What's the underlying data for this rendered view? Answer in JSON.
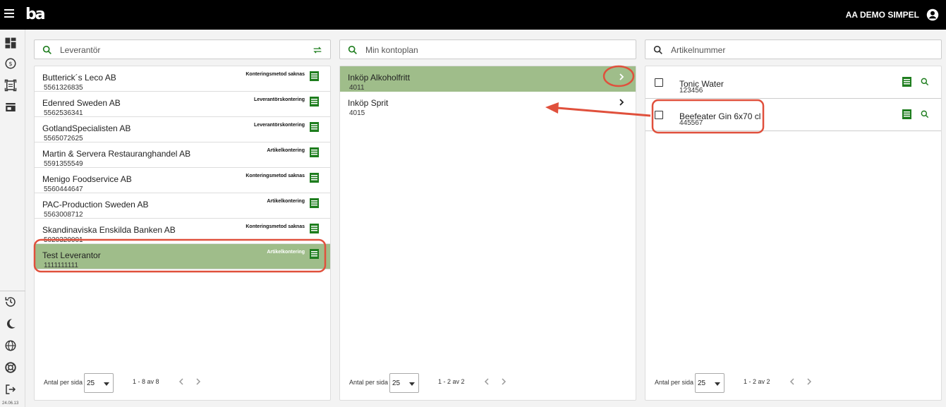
{
  "header": {
    "logo": "ba",
    "user_name": "AA DEMO SIMPEL"
  },
  "rail": {
    "version": "24.06.13"
  },
  "search": {
    "supplier_placeholder": "Leverantör",
    "account_placeholder": "Min kontoplan",
    "article_placeholder": "Artikelnummer"
  },
  "suppliers": [
    {
      "name": "Butterick´s Leco AB",
      "number": "5561326835",
      "tag": "Konteringsmetod saknas"
    },
    {
      "name": "Edenred Sweden AB",
      "number": "5562536341",
      "tag": "Leverantörskontering"
    },
    {
      "name": "GotlandSpecialisten AB",
      "number": "5565072625",
      "tag": "Leverantörskontering"
    },
    {
      "name": "Martin & Servera Restauranghandel AB",
      "number": "5591355549",
      "tag": "Artikelkontering"
    },
    {
      "name": "Menigo Foodservice AB",
      "number": "5560444647",
      "tag": "Konteringsmetod saknas"
    },
    {
      "name": "PAC-Production Sweden AB",
      "number": "5563008712",
      "tag": "Artikelkontering"
    },
    {
      "name": "Skandinaviska Enskilda Banken AB",
      "number": "5020320001",
      "tag": "Konteringsmetod saknas"
    },
    {
      "name": "Test Leverantor",
      "number": "1111111111",
      "tag": "Artikelkontering"
    }
  ],
  "accounts": [
    {
      "name": "Inköp Alkoholfritt",
      "number": "4011"
    },
    {
      "name": "Inköp Sprit",
      "number": "4015"
    }
  ],
  "articles": [
    {
      "name": "Tonic Water",
      "number": "123456"
    },
    {
      "name": "Beefeater Gin 6x70 cl",
      "number": "445567"
    }
  ],
  "pager": {
    "per_page_label": "Antal per sida",
    "per_page_value": "25",
    "suppliers_range": "1 - 8 av 8",
    "accounts_range": "1 - 2 av 2",
    "articles_range": "1 - 2 av 2"
  },
  "colors": {
    "accent": "#1e7d1e",
    "selected": "#9fbd8a",
    "annotation": "#e0503c"
  }
}
